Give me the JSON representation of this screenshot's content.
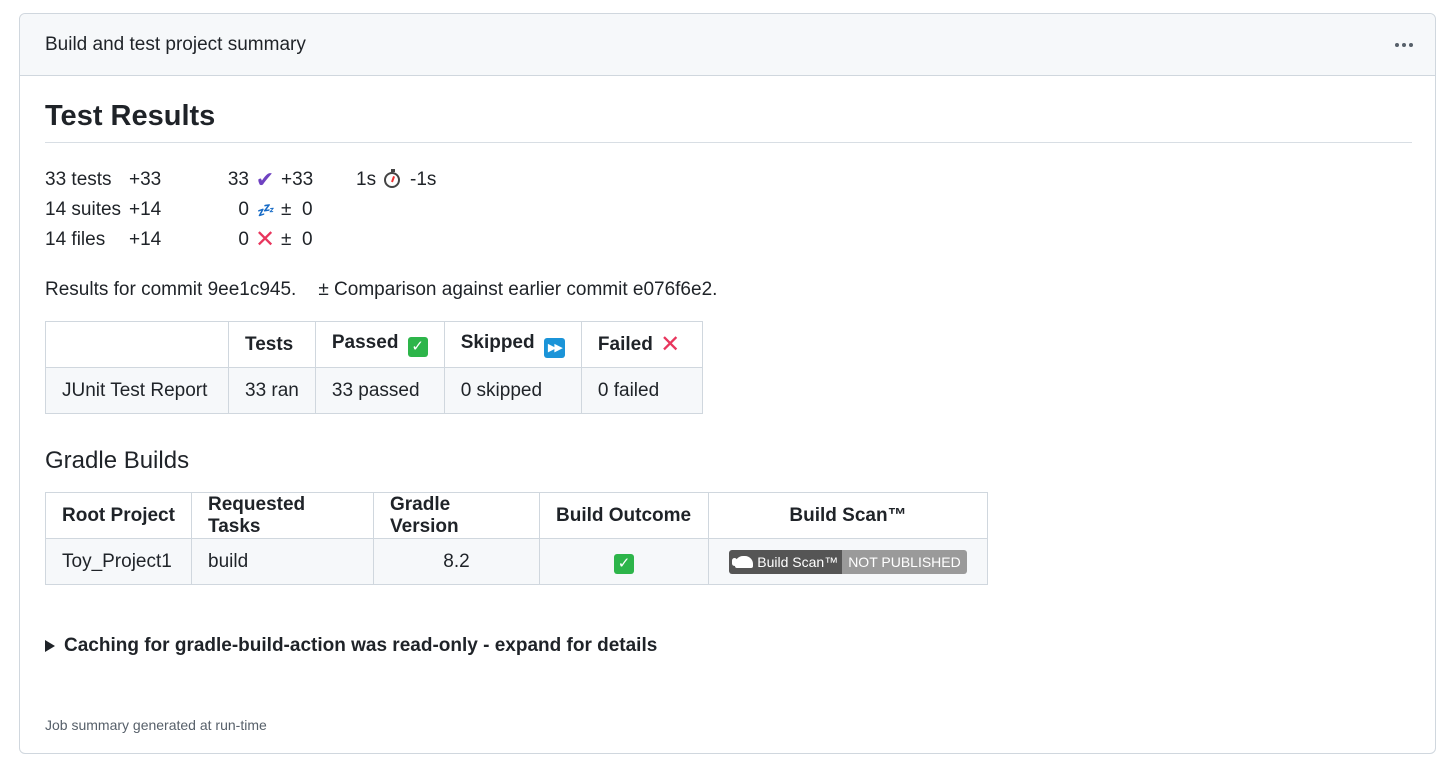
{
  "header": {
    "title": "Build and test project summary"
  },
  "test_results": {
    "heading": "Test Results",
    "stats": [
      {
        "label": "33 tests",
        "delta": "+33",
        "count": "33",
        "icon": "check-icon",
        "icon_delta": "+33",
        "time": "1s",
        "time_icon": "stopwatch-icon",
        "time_delta": "-1s"
      },
      {
        "label": "14 suites",
        "delta": "+14",
        "count": "0",
        "icon": "sleep-icon",
        "icon_delta": "±  0"
      },
      {
        "label": "14 files",
        "delta": "+14",
        "count": "0",
        "icon": "x-icon",
        "icon_delta": "±  0"
      }
    ],
    "commit_text": "Results for commit 9ee1c945.",
    "comparison_text": "± Comparison against earlier commit e076f6e2.",
    "table": {
      "headers": [
        "",
        "Tests",
        "Passed",
        "Skipped",
        "Failed"
      ],
      "row": [
        "JUnit Test Report",
        "33 ran",
        "33 passed",
        "0 skipped",
        "0 failed"
      ]
    }
  },
  "gradle": {
    "heading": "Gradle Builds",
    "headers": [
      "Root Project",
      "Requested Tasks",
      "Gradle Version",
      "Build Outcome",
      "Build Scan™"
    ],
    "row": {
      "project": "Toy_Project1",
      "tasks": "build",
      "version": "8.2",
      "outcome_icon": "check-box-icon"
    },
    "badge_left": "Build Scan™",
    "badge_right": "NOT PUBLISHED"
  },
  "details_summary": "Caching for gradle-build-action was read-only - expand for details",
  "footer": "Job summary generated at run-time",
  "colors": {
    "purple_check": "#6f42c1",
    "red_x": "#e8365d",
    "green_badge": "#2db54a",
    "blue_badge": "#1b94d8"
  }
}
